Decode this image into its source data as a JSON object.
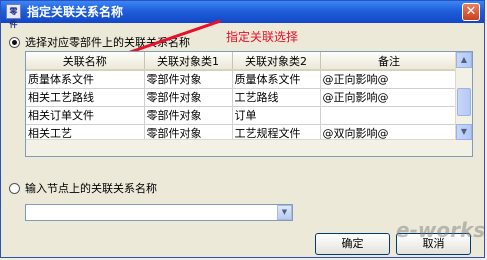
{
  "window": {
    "title": "指定关联关系名称",
    "app_icon_text": "零件",
    "close_symbol": "✕"
  },
  "option1": {
    "label": "选择对应零部件上的关联关系名称",
    "selected": true
  },
  "annotation": {
    "text": "指定关联选择",
    "color": "#e8102a"
  },
  "table": {
    "headers": [
      "关联名称",
      "关联对象类1",
      "关联对象类2",
      "备注"
    ],
    "rows": [
      [
        "质量体系文件",
        "零部件对象",
        "质量体系文件",
        "@正向影响@"
      ],
      [
        "相关工艺路线",
        "零部件对象",
        "工艺路线",
        "@正向影响@"
      ],
      [
        "相关订单文件",
        "零部件对象",
        "订单",
        ""
      ],
      [
        "相关工艺",
        "零部件对象",
        "工艺规程文件",
        "@双向影响@"
      ]
    ]
  },
  "option2": {
    "label": "输入节点上的关联关系名称",
    "selected": false
  },
  "combo": {
    "value": ""
  },
  "buttons": {
    "ok": "确定",
    "cancel": "取消"
  },
  "watermark": "e-works"
}
